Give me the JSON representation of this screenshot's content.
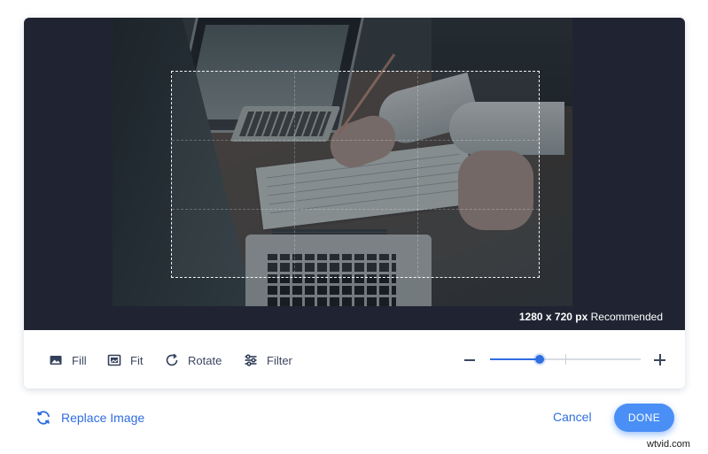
{
  "editor": {
    "recommendation": {
      "size": "1280 x 720 px",
      "label": "Recommended"
    }
  },
  "toolbar": {
    "tools": [
      {
        "label": "Fill",
        "icon": "image-icon"
      },
      {
        "label": "Fit",
        "icon": "image-frame-icon"
      },
      {
        "label": "Rotate",
        "icon": "rotate-icon"
      },
      {
        "label": "Filter",
        "icon": "sliders-icon"
      }
    ],
    "zoom": {
      "level_fraction": 0.33,
      "minus_icon": "minus-icon",
      "plus_icon": "plus-icon"
    }
  },
  "footer": {
    "replace_label": "Replace Image",
    "replace_icon": "refresh-icon",
    "cancel_label": "Cancel",
    "done_label": "DONE"
  },
  "watermark": "wtvid.com",
  "colors": {
    "accent": "#2f6de1",
    "done_button": "#4a8ff6",
    "canvas_bg": "#202432",
    "text": "#3b4660"
  }
}
